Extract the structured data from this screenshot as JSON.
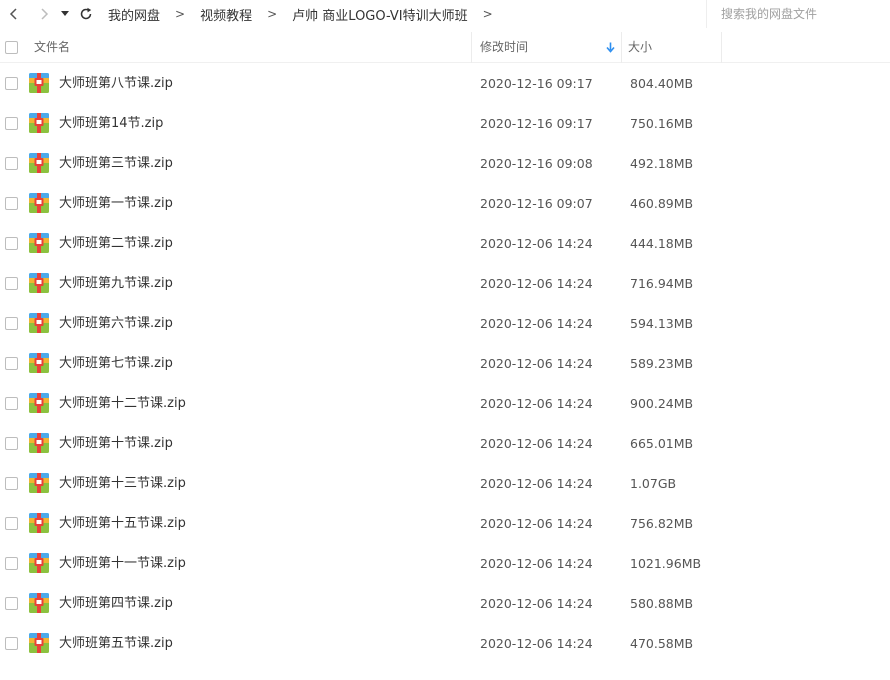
{
  "nav": {
    "back_icon": "chevron-left-icon",
    "forward_icon": "chevron-right-icon",
    "history_icon": "caret-down-icon",
    "refresh_icon": "refresh-icon",
    "breadcrumb": [
      {
        "label": "我的网盘"
      },
      {
        "label": "视频教程"
      },
      {
        "label": "卢帅 商业LOGO-VI特训大师班"
      }
    ],
    "separator": ">"
  },
  "search": {
    "placeholder": "搜索我的网盘文件",
    "value": ""
  },
  "columns": {
    "name": "文件名",
    "mtime": "修改时间",
    "size": "大小",
    "sort_icon": "arrow-down-icon"
  },
  "colors": {
    "accent": "#2e8ff0",
    "zip_icon": [
      "#4aa9e9",
      "#f0b532",
      "#8cc23f",
      "#e8413a"
    ]
  },
  "files": [
    {
      "name": "大师班第八节课.zip",
      "mtime": "2020-12-16 09:17",
      "size": "804.40MB",
      "icon": "zip-archive-icon"
    },
    {
      "name": "大师班第14节.zip",
      "mtime": "2020-12-16 09:17",
      "size": "750.16MB",
      "icon": "zip-archive-icon"
    },
    {
      "name": "大师班第三节课.zip",
      "mtime": "2020-12-16 09:08",
      "size": "492.18MB",
      "icon": "zip-archive-icon"
    },
    {
      "name": "大师班第一节课.zip",
      "mtime": "2020-12-16 09:07",
      "size": "460.89MB",
      "icon": "zip-archive-icon"
    },
    {
      "name": "大师班第二节课.zip",
      "mtime": "2020-12-06 14:24",
      "size": "444.18MB",
      "icon": "zip-archive-icon"
    },
    {
      "name": "大师班第九节课.zip",
      "mtime": "2020-12-06 14:24",
      "size": "716.94MB",
      "icon": "zip-archive-icon"
    },
    {
      "name": "大师班第六节课.zip",
      "mtime": "2020-12-06 14:24",
      "size": "594.13MB",
      "icon": "zip-archive-icon"
    },
    {
      "name": "大师班第七节课.zip",
      "mtime": "2020-12-06 14:24",
      "size": "589.23MB",
      "icon": "zip-archive-icon"
    },
    {
      "name": "大师班第十二节课.zip",
      "mtime": "2020-12-06 14:24",
      "size": "900.24MB",
      "icon": "zip-archive-icon"
    },
    {
      "name": "大师班第十节课.zip",
      "mtime": "2020-12-06 14:24",
      "size": "665.01MB",
      "icon": "zip-archive-icon"
    },
    {
      "name": "大师班第十三节课.zip",
      "mtime": "2020-12-06 14:24",
      "size": "1.07GB",
      "icon": "zip-archive-icon"
    },
    {
      "name": "大师班第十五节课.zip",
      "mtime": "2020-12-06 14:24",
      "size": "756.82MB",
      "icon": "zip-archive-icon"
    },
    {
      "name": "大师班第十一节课.zip",
      "mtime": "2020-12-06 14:24",
      "size": "1021.96MB",
      "icon": "zip-archive-icon"
    },
    {
      "name": "大师班第四节课.zip",
      "mtime": "2020-12-06 14:24",
      "size": "580.88MB",
      "icon": "zip-archive-icon"
    },
    {
      "name": "大师班第五节课.zip",
      "mtime": "2020-12-06 14:24",
      "size": "470.58MB",
      "icon": "zip-archive-icon"
    }
  ]
}
